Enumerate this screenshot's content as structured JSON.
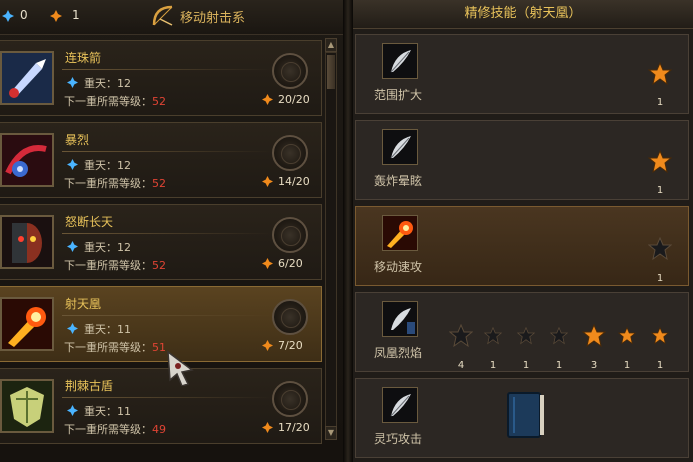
{
  "top_bar": {
    "currency_blue": "0",
    "currency_orange": "1",
    "skill_school": "移动射击系"
  },
  "skills": [
    {
      "name": "连珠箭",
      "rank_label": "重天：12",
      "req_label": "下一重所需等级：",
      "req_level": "52",
      "points": "20/20",
      "icon": "arrow-skill-icon",
      "selected": false
    },
    {
      "name": "暴烈",
      "rank_label": "重天：12",
      "req_label": "下一重所需等级：",
      "req_level": "52",
      "points": "14/20",
      "icon": "bow-burst-icon",
      "selected": false
    },
    {
      "name": "怒断长天",
      "rank_label": "重天：12",
      "req_label": "下一重所需等级：",
      "req_level": "52",
      "points": "6/20",
      "icon": "fury-face-icon",
      "selected": false
    },
    {
      "name": "射天凰",
      "rank_label": "重天：11",
      "req_label": "下一重所需等级：",
      "req_level": "51",
      "points": "7/20",
      "icon": "phoenix-shot-icon",
      "selected": true
    },
    {
      "name": "荆棘古盾",
      "rank_label": "重天：11",
      "req_label": "下一重所需等级：",
      "req_level": "49",
      "points": "17/20",
      "icon": "thorn-shield-icon",
      "selected": false
    }
  ],
  "refine_panel": {
    "title": "精修技能（射天凰）",
    "items": [
      {
        "name": "范围扩大",
        "stars": [
          "1"
        ]
      },
      {
        "name": "轰炸晕眩",
        "stars": [
          "1"
        ]
      },
      {
        "name": "移动速攻",
        "stars": [
          "1"
        ]
      },
      {
        "name": "凤凰烈焰",
        "stars": [
          "4",
          "1",
          "1",
          "1",
          "3",
          "1",
          "1"
        ]
      },
      {
        "name": "灵巧攻击",
        "stars": []
      }
    ]
  },
  "colors": {
    "gold_text": "#e8c25a",
    "required_level_red": "#e04434",
    "active_star_orange": "#f08a1c",
    "inactive_star_dark": "#1a1a1c"
  }
}
